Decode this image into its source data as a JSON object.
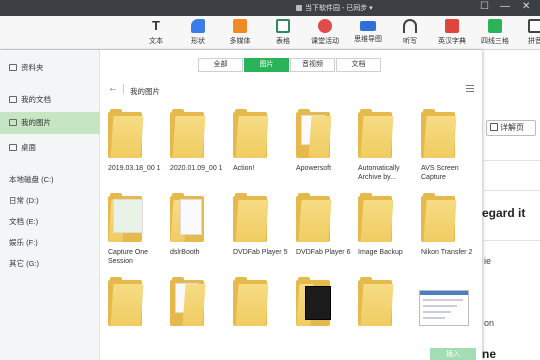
{
  "app": {
    "doc_title": "当下软件园 - 已同步",
    "controls": [
      "☐",
      "—",
      "✕"
    ]
  },
  "ribbon": [
    {
      "label": "文本",
      "icon": "text-icon",
      "color": "#333333"
    },
    {
      "label": "形状",
      "icon": "shape-icon",
      "color": "#3b7de8"
    },
    {
      "label": "多媒体",
      "icon": "media-icon",
      "color": "#f08a24"
    },
    {
      "label": "表格",
      "icon": "table-icon",
      "color": "#2e8b57"
    },
    {
      "label": "课堂活动",
      "icon": "class-activity-icon",
      "color": "#e24b4b"
    },
    {
      "label": "思维导图",
      "icon": "mindmap-icon",
      "color": "#2f6fdc"
    },
    {
      "label": "听写",
      "icon": "dictation-icon",
      "color": "#444444"
    },
    {
      "label": "英汉字典",
      "icon": "dictionary-icon",
      "color": "#e0443c"
    },
    {
      "label": "四线三格",
      "icon": "four-line-icon",
      "color": "#2bb35a"
    },
    {
      "label": "拼音",
      "icon": "pinyin-icon",
      "color": "#444444"
    }
  ],
  "sidebar": {
    "items": [
      {
        "label": "资料夹",
        "icon": "folder-icon",
        "active": false
      },
      {
        "label": "我的文档",
        "icon": "documents-icon",
        "active": false
      },
      {
        "label": "我的图片",
        "icon": "pictures-icon",
        "active": true
      },
      {
        "label": "桌面",
        "icon": "desktop-icon",
        "active": false
      }
    ],
    "drives": [
      {
        "label": "本地磁盘 (C:)"
      },
      {
        "label": "日常 (D:)"
      },
      {
        "label": "文档 (E:)"
      },
      {
        "label": "娱乐 (F:)"
      },
      {
        "label": "其它 (G:)"
      }
    ]
  },
  "tabs": [
    {
      "label": "全部",
      "active": false
    },
    {
      "label": "图片",
      "active": true
    },
    {
      "label": "音视频",
      "active": false
    },
    {
      "label": "文档",
      "active": false
    }
  ],
  "path": {
    "back": "←",
    "current": "我的图片"
  },
  "files": [
    {
      "name": "2019.03.18_00 1",
      "type": "folder"
    },
    {
      "name": "2020.01.09_00 1",
      "type": "folder"
    },
    {
      "name": "Action!",
      "type": "folder"
    },
    {
      "name": "Apowersoft",
      "type": "folder-files"
    },
    {
      "name": "Automatically Archive by...",
      "type": "folder"
    },
    {
      "name": "AVS Screen Capture",
      "type": "folder"
    },
    {
      "name": "Capture One Session",
      "type": "folder-preview"
    },
    {
      "name": "dslrBooth",
      "type": "folder-paper"
    },
    {
      "name": "DVDFab Player 5",
      "type": "folder"
    },
    {
      "name": "DVDFab Player 6",
      "type": "folder"
    },
    {
      "name": "Image Backup",
      "type": "folder"
    },
    {
      "name": "Nikon Transfer 2",
      "type": "folder"
    },
    {
      "name": "",
      "type": "folder"
    },
    {
      "name": "",
      "type": "folder-files"
    },
    {
      "name": "",
      "type": "folder"
    },
    {
      "name": "",
      "type": "folder-dark"
    },
    {
      "name": "",
      "type": "folder"
    },
    {
      "name": "",
      "type": "image"
    }
  ],
  "actions": {
    "insert": "插入"
  },
  "background_doc": {
    "detail_button": "详解页",
    "regard_text": "egard it",
    "frag1": "ie",
    "frag2": "on",
    "frag3": "ne"
  }
}
